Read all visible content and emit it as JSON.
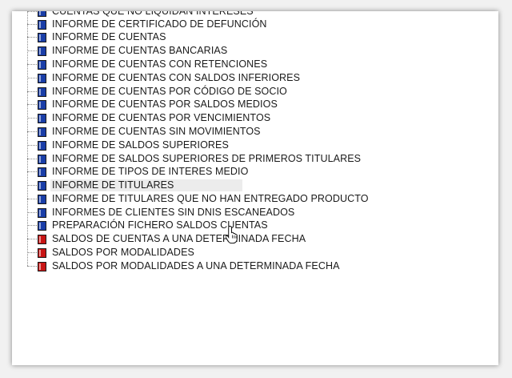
{
  "tree": {
    "items": [
      {
        "label": "CUENTAS QUE NO LIQUIDAN INTERESES",
        "icon": "book-blue-icon",
        "color": "#1a3ea8"
      },
      {
        "label": "INFORME DE CERTIFICADO DE DEFUNCIÓN",
        "icon": "book-blue-icon",
        "color": "#1a3ea8"
      },
      {
        "label": "INFORME DE CUENTAS",
        "icon": "book-blue-icon",
        "color": "#1a3ea8"
      },
      {
        "label": "INFORME DE CUENTAS BANCARIAS",
        "icon": "book-blue-icon",
        "color": "#1a3ea8"
      },
      {
        "label": "INFORME DE CUENTAS CON RETENCIONES",
        "icon": "book-blue-icon",
        "color": "#1a3ea8"
      },
      {
        "label": "INFORME DE CUENTAS CON SALDOS INFERIORES",
        "icon": "book-blue-icon",
        "color": "#1a3ea8"
      },
      {
        "label": "INFORME DE CUENTAS POR CÓDIGO DE SOCIO",
        "icon": "book-blue-icon",
        "color": "#1a3ea8"
      },
      {
        "label": "INFORME DE CUENTAS POR SALDOS MEDIOS",
        "icon": "book-blue-icon",
        "color": "#1a3ea8"
      },
      {
        "label": "INFORME DE CUENTAS POR VENCIMIENTOS",
        "icon": "book-blue-icon",
        "color": "#1a3ea8"
      },
      {
        "label": "INFORME DE CUENTAS SIN MOVIMIENTOS",
        "icon": "book-blue-icon",
        "color": "#1a3ea8"
      },
      {
        "label": "INFORME DE SALDOS SUPERIORES",
        "icon": "book-blue-icon",
        "color": "#1a3ea8"
      },
      {
        "label": "INFORME DE SALDOS SUPERIORES DE PRIMEROS TITULARES",
        "icon": "book-blue-icon",
        "color": "#1a3ea8"
      },
      {
        "label": "INFORME DE TIPOS DE INTERES MEDIO",
        "icon": "book-blue-icon",
        "color": "#1a3ea8"
      },
      {
        "label": "INFORME DE TITULARES",
        "icon": "book-blue-icon",
        "color": "#1a3ea8",
        "selected": true
      },
      {
        "label": "INFORME DE TITULARES QUE NO HAN ENTREGADO PRODUCTO",
        "icon": "book-blue-icon",
        "color": "#1a3ea8"
      },
      {
        "label": "INFORMES DE CLIENTES SIN DNIS ESCANEADOS",
        "icon": "book-blue-icon",
        "color": "#1a3ea8"
      },
      {
        "label": "PREPARACIÓN FICHERO SALDOS CUENTAS",
        "icon": "book-blue-icon",
        "color": "#1a3ea8"
      },
      {
        "label": "SALDOS DE CUENTAS A UNA DETERMINADA FECHA",
        "icon": "book-red-icon",
        "color": "#c81515"
      },
      {
        "label": "SALDOS POR MODALIDADES",
        "icon": "book-red-icon",
        "color": "#c81515"
      },
      {
        "label": "SALDOS POR MODALIDADES A UNA DETERMINADA FECHA",
        "icon": "book-red-icon",
        "color": "#c81515"
      }
    ]
  }
}
